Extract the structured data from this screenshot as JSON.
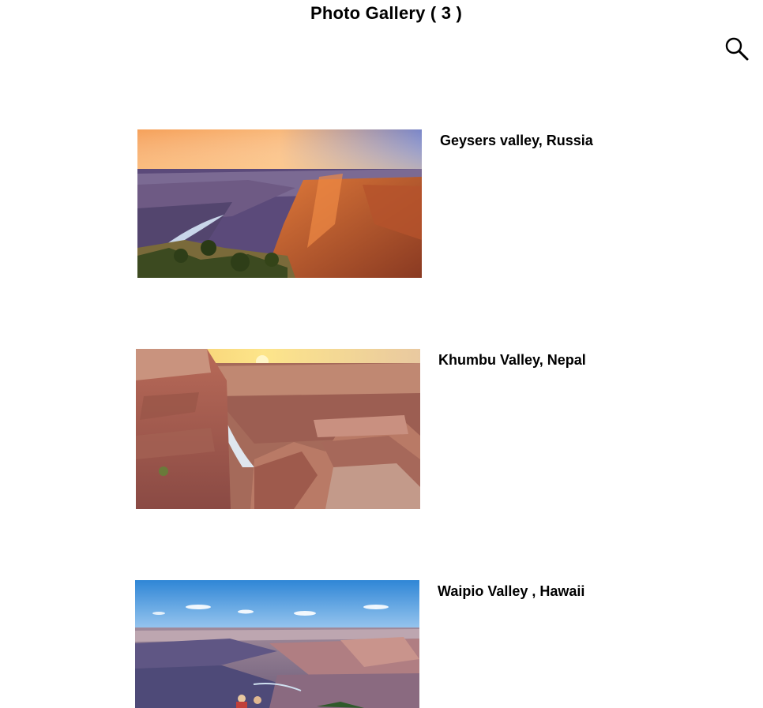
{
  "header": {
    "title": "Photo Gallery ( 3 )"
  },
  "toolbar": {
    "search_icon": "search-icon"
  },
  "gallery": {
    "items": [
      {
        "caption": "Geysers valley, Russia",
        "image_subject": "canyon at sunset with river"
      },
      {
        "caption": "Khumbu Valley, Nepal",
        "image_subject": "red rock canyon cliffs with river at sunrise"
      },
      {
        "caption": "Waipio Valley , Hawaii",
        "image_subject": "canyon under blue sky with clouds"
      }
    ]
  }
}
